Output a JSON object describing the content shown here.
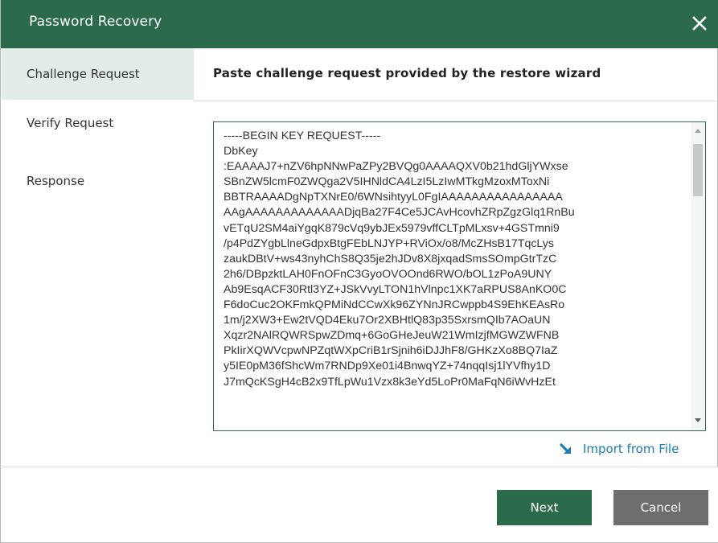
{
  "window": {
    "title": "Password Recovery"
  },
  "sidebar": {
    "items": [
      {
        "label": "Challenge Request",
        "active": true
      },
      {
        "label": "Verify Request",
        "active": false
      },
      {
        "label": "Response",
        "active": false
      }
    ]
  },
  "main": {
    "heading": "Paste challenge request provided by the restore wizard",
    "request_text": "-----BEGIN KEY REQUEST-----\nDbKey\n:EAAAAJ7+nZV6hpNNwPaZPy2BVQg0AAAAQXV0b21hdGljYWxse\nSBnZW5lcmF0ZWQga2V5IHNldCA4LzI5LzIwMTkgMzoxMToxNi\nBBTRAAAADgNpTXNrE0/6WNsihtyyL0FgIAAAAAAAAAAAAAAAA\nAAgAAAAAAAAAAAAADjqBa27F4Ce5JCAvHcovhZRpZgzGlq1RnBu\nvETqU2SM4aiYgqK879cVq9ybJEx5979vffCLTpMLxsv+4GSTmni9\n/p4PdZYgbLlneGdpxBtgFEbLNJYP+RViOx/o8/McZHsB17TqcLys\nzaukDBtV+ws43nyhChS8Q35je2hJDv8X8jxqadSmsSOmpGtrTzC\n2h6/DBpzktLAH0FnOFnC3GyoOVOOnd6RWO/bOL1zPoA9UNY\nAb9EsqACF30Rtl3YZ+JSkVvyLTON1hVlnpc1XK7aRPUS8AnKO0C\nF6doCuc2OKFmkQPMiNdCCwXk96ZYNnJRCwppb4S9EhKEAsRo\n1m/j2XW3+Ew2tVQD4Eku7Or2XBHtlQ83p35SxrsmQIb7AOaUN\nXqzr2NAlRQWRSpwZDmq+6GoGHeJeuW21WmIzjfMGWZWFNB\nPkIirXQWVcpwNPZqtWXpCriB1rSjnih6iDJJhF8/GHKzXo8BQ7IaZ\ny5IE0pM36fShcWm7RNDp9Xe01i4BnwqYZ+74nqqIsj1lYVfhy1D\nJ7mQcKSgH4cB2x9TfLpWu1Vzx8k3eYd5LoPr0MaFqN6iWvHzEt",
    "import_label": "Import from File"
  },
  "footer": {
    "next_label": "Next",
    "cancel_label": "Cancel"
  },
  "icons": {
    "close": "close-icon",
    "import": "import-arrow-icon"
  },
  "colors": {
    "accent": "#2b6b4c",
    "sidebar_active": "#e3ede7",
    "link": "#1f7bb6",
    "cancel": "#6e6e6e"
  }
}
